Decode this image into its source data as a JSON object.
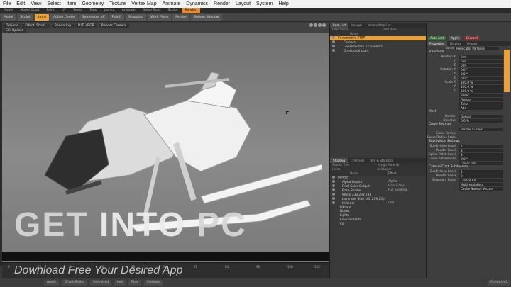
{
  "menubar": [
    "File",
    "Edit",
    "View",
    "Select",
    "Item",
    "Geometry",
    "Texture",
    "Vertex Map",
    "Animate",
    "Dynamics",
    "Render",
    "Layout",
    "System",
    "Help"
  ],
  "tabs": [
    "Model",
    "Model Quad",
    "Paint",
    "UV",
    "Setup",
    "Topo",
    "Layout",
    "Animate",
    "Game Tools",
    "Sculpt",
    "Render"
  ],
  "active_tab": "Render",
  "toolbar": {
    "mode": "Model",
    "sel": "Sculpt",
    "items": [
      "Items",
      "Action Center",
      "Symmetry: off",
      "Falloff",
      "Snapping",
      "Work Plane",
      "Render",
      "Render Window"
    ],
    "hot": "Items"
  },
  "viewport": {
    "tabs": [
      "Options",
      "Effect: Shad...",
      "Rendering",
      "LUT: sRGB",
      "Render Camera",
      "SC: Update"
    ]
  },
  "watermark": {
    "line1_a": "GET ",
    "line1_b": "INTO",
    "line1_c": " PC",
    "line2": "Download Free Your Desired App"
  },
  "timeline": {
    "ticks": [
      "0",
      "12",
      "24",
      "36",
      "48",
      "60",
      "72",
      "84",
      "96",
      "108",
      "120"
    ]
  },
  "bottombar": [
    "Audio",
    "Graph Editor",
    "Animated",
    "Key",
    "Play",
    "Settings",
    "Command"
  ],
  "items_panel": {
    "tabs": [
      "Item List",
      "Images",
      "Vertex Map List"
    ],
    "header_left": "Name",
    "filter": "Filter Items",
    "add": "Add Item",
    "rows": [
      {
        "t": "Snowmobile STEP",
        "sel": true
      },
      {
        "t": "Camera",
        "sel": false
      },
      {
        "t": "Lowsnow 005 5X variants",
        "sel": false
      },
      {
        "t": "Directional Light",
        "sel": false
      }
    ]
  },
  "shading_panel": {
    "tabs": [
      "Shading",
      "Channels",
      "Info & Statistics"
    ],
    "view": "Shader Tree",
    "view_right": "Assign Material",
    "filter": "(none)",
    "add_layer": "Add Layer",
    "col_name": "Name",
    "col_effect": "Effect",
    "rows": [
      {
        "t": "Render",
        "e": ""
      },
      {
        "t": "Alpha Output",
        "e": "Alpha"
      },
      {
        "t": "Final Color Output",
        "e": "Final Color"
      },
      {
        "t": "Base Shader",
        "e": "Full Shading"
      },
      {
        "t": "White 233 233 233",
        "e": ""
      },
      {
        "t": "Lavender Blue 162 209 230",
        "e": ""
      },
      {
        "t": "Material",
        "e": "(all)"
      },
      {
        "t": "Library",
        "e": ""
      },
      {
        "t": "Nodes",
        "e": ""
      },
      {
        "t": "Lights",
        "e": ""
      },
      {
        "t": "Environments",
        "e": ""
      },
      {
        "t": "FX",
        "e": ""
      }
    ]
  },
  "right_panel": {
    "buttons": {
      "auto_add": "Auto Add",
      "apply": "Apply",
      "discard": "Discard"
    },
    "tabs": [
      "Properties",
      "Display",
      "Groups"
    ],
    "name_label": "Name",
    "name_value": "Replicator Particles",
    "transform": "Transform",
    "rows": [
      {
        "l": "Position X",
        "v": "0 m"
      },
      {
        "l": "Y",
        "v": "0 m"
      },
      {
        "l": "Z",
        "v": "0 m"
      },
      {
        "l": "Rotation X",
        "v": "0.0 °"
      },
      {
        "l": "Y",
        "v": "0.0 °"
      },
      {
        "l": "Z",
        "v": "0.0 °"
      },
      {
        "l": "Scale X",
        "v": "100.0 %"
      },
      {
        "l": "Y",
        "v": "100.0 %"
      },
      {
        "l": "Z",
        "v": "100.0 %"
      }
    ],
    "actions": [
      "Reset",
      "Freeze",
      "Zero",
      "Add"
    ],
    "mesh": "Mesh",
    "render_label": "Render",
    "render_value": "Default",
    "dissolve_label": "Dissolve",
    "dissolve_value": "0.0 %",
    "curve": "Curve Settings",
    "curve_rows": [
      "Render Curves",
      "Curve Radius",
      "Curve Radius Scale"
    ],
    "sub": "Subdivision Settings",
    "sub_rows": [
      {
        "l": "Subdivision Level",
        "v": "2"
      },
      {
        "l": "Render Level",
        "v": "3"
      },
      {
        "l": "Spline Patch Level",
        "v": "3"
      },
      {
        "l": "Curve Refinement",
        "v": "0.0 °"
      }
    ],
    "linear": "Linear UVs",
    "cc": "Catmull-Clark Subdivision",
    "cc_rows": [
      {
        "l": "Subdivision Level",
        "v": "2"
      },
      {
        "l": "Render Level",
        "v": "2"
      },
      {
        "l": "Boundary Rules",
        "v": "Crease All"
      }
    ],
    "checks": [
      "Multiresolution",
      "Cache Normal Vectors"
    ]
  }
}
